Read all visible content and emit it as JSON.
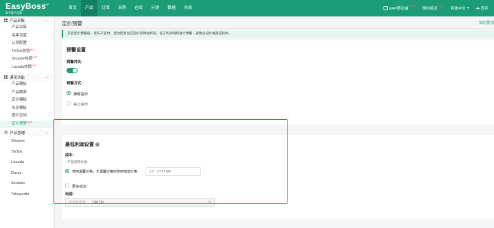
{
  "app": {
    "brand": "EasyBoss",
    "brand_tag": "ERP",
    "brand_sub": "助手兼下品牌"
  },
  "nav": {
    "items": [
      "首页",
      "产品",
      "订单",
      "采购",
      "仓库",
      "分销",
      "数据",
      "系统"
    ],
    "active_index": 1
  },
  "top_right": {
    "erp_mobile": "ERP移动端",
    "erp_mobile_badge": "NEW",
    "training": "预约培训",
    "training_badge": "HOT",
    "language": "简体中文",
    "sync": "同步"
  },
  "sidebar": {
    "sections": [
      {
        "title": "产品采集",
        "items": [
          {
            "label": "产品采集",
            "badge": ""
          },
          {
            "label": "采集设置",
            "badge": ""
          },
          {
            "label": "认领配置",
            "badge": ""
          },
          {
            "label": "TikTok热销",
            "badge": "HOT"
          },
          {
            "label": "Shopee热销",
            "badge": "HOT"
          },
          {
            "label": "Lazada热销",
            "badge": "HOT"
          }
        ]
      },
      {
        "title": "通用功能",
        "items": [
          {
            "label": "产品模板",
            "badge": ""
          },
          {
            "label": "产品搬家",
            "badge": ""
          },
          {
            "label": "定价模板",
            "badge": ""
          },
          {
            "label": "水印模板",
            "badge": ""
          },
          {
            "label": "图片空间",
            "badge": ""
          },
          {
            "label": "定价预警",
            "badge": "NEW"
          }
        ]
      },
      {
        "title": "产品管理",
        "items": [
          {
            "label": "Shopee",
            "badge": ""
          },
          {
            "label": "TikTok",
            "badge": ""
          },
          {
            "label": "Lazada",
            "badge": ""
          },
          {
            "label": "Daraz",
            "badge": ""
          },
          {
            "label": "Akulaku",
            "badge": ""
          },
          {
            "label": "Tokopedia",
            "badge": ""
          }
        ]
      }
    ]
  },
  "page": {
    "title": "定价预警",
    "help_link": "如何使用",
    "notice": "开启定价预警后，发布产品时，自动检测当前定价的预估利润，低于利润限制进行预警，避免误设价格造成损失。"
  },
  "warning_settings": {
    "title": "预警设置",
    "switch_label": "预警开关:",
    "switch_on": true,
    "method_label": "预警方式:",
    "options": [
      "弹窗提示",
      "禁止操作"
    ],
    "selected_index": 0
  },
  "min_profit": {
    "title": "最低利润设置",
    "help_icon": "?",
    "cost_label": "成本:",
    "purchase_price_label": "* 产品采购价格:",
    "purchase_option": "使用温馨价格，无温馨价格时使用储值价格",
    "currency": "IDR",
    "price_value": "7777.00",
    "more_cost_label": "更多成本",
    "profit_label": "利润:",
    "profit_rate_label": "成本利润率",
    "profit_rate_value": "190.00",
    "percent": "%"
  },
  "colors": {
    "brand": "#1b9e77",
    "highlight": "#e53935",
    "badge": "#ff4d4f"
  }
}
